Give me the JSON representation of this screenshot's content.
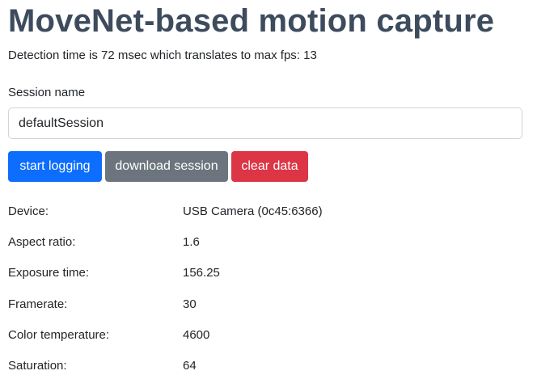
{
  "header": {
    "title": "MoveNet-based motion capture",
    "detection_text": "Detection time is 72 msec which translates to max fps: 13"
  },
  "session": {
    "label": "Session name",
    "value": "defaultSession"
  },
  "buttons": {
    "start_logging": "start logging",
    "download_session": "download session",
    "clear_data": "clear data"
  },
  "colors": {
    "title": "#3d4b5d",
    "primary": "#0d6efd",
    "secondary": "#6c757d",
    "danger": "#dc3545"
  },
  "properties": [
    {
      "label": "Device:",
      "value": "USB Camera (0c45:6366)"
    },
    {
      "label": "Aspect ratio:",
      "value": "1.6"
    },
    {
      "label": "Exposure time:",
      "value": "156.25"
    },
    {
      "label": "Framerate:",
      "value": "30"
    },
    {
      "label": "Color temperature:",
      "value": "4600"
    },
    {
      "label": "Saturation:",
      "value": "64"
    }
  ]
}
